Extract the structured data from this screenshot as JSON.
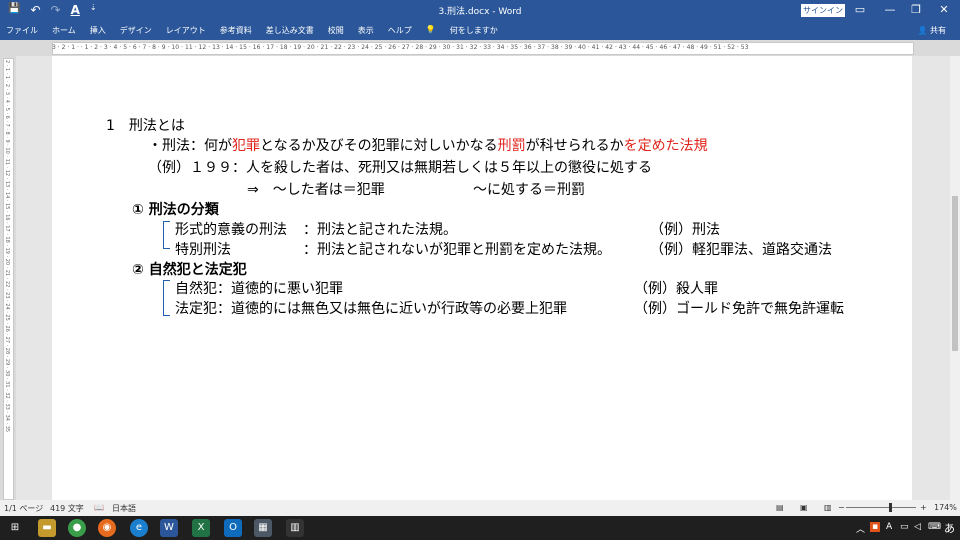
{
  "window": {
    "title": "3.刑法.docx  -  Word",
    "signin_label": "サインイン",
    "controls": [
      "▭",
      "—",
      "❐",
      "✕"
    ]
  },
  "qat": {
    "save_icon": "💾",
    "undo_icon": "↶",
    "redo_icon": "↷",
    "font_color_icon": "A",
    "customize_icon": "⇣"
  },
  "menu": {
    "tabs": [
      "ファイル",
      "ホーム",
      "挿入",
      "デザイン",
      "レイアウト",
      "参考資料",
      "差し込み文書",
      "校閲",
      "表示",
      "ヘルプ"
    ],
    "tellme": "何をしますか",
    "share": "共有"
  },
  "ruler": {
    "numbers": "3 ⸱ 2 ⸱ 1 ⸱  ⸱ 1 ⸱ 2 ⸱ 3 ⸱ 4 ⸱ 5 ⸱ 6 ⸱ 7 ⸱ 8 ⸱ 9 ⸱ 10 ⸱ 11 ⸱ 12 ⸱ 13 ⸱ 14 ⸱ 15 ⸱ 16 ⸱ 17 ⸱ 18 ⸱ 19 ⸱ 20 ⸱ 21 ⸱ 22 ⸱ 23 ⸱ 24 ⸱ 25 ⸱ 26 ⸱ 27 ⸱ 28 ⸱ 29 ⸱ 30 ⸱ 31 ⸱ 32 ⸱ 33 ⸱ 34 ⸱ 35 ⸱ 36 ⸱ 37 ⸱ 38 ⸱ 39 ⸱ 40 ⸱ 41 ⸱ 42 ⸱ 43 ⸱ 44 ⸱ 45 ⸱ 46 ⸱ 47 ⸱ 48 ⸱ 49 ⸱ 51 ⸱ 52 ⸱ 53"
  },
  "vruler": {
    "numbers": "2 · 1 · 1 · 2 · 3 · 4 · 5 · 6 · 7 · 8 · 9 · 10 · 11 · 12 · 13 · 14 · 15 · 16 · 17 · 18 · 19 · 20 · 21 · 22 · 23 · 24 · 25 · 26 · 27 · 28 · 29 · 30 · 31 · 32 · 33 · 34 · 35"
  },
  "document": {
    "heading": "1　刑法とは",
    "def_prefix": "・刑法：何が",
    "def_red1": "犯罪",
    "def_mid1": "となるか及びその犯罪に対しいかなる",
    "def_red2": "刑罰",
    "def_mid2": "が科せられるか",
    "def_red3": "を定めた法規",
    "example_line": "（例）１９９：人を殺した者は、死刑又は無期若しくは５年以上の懲役に処する",
    "arrow_line1": "⇒　～した者は＝犯罪",
    "arrow_line2": "～に処する＝刑罰",
    "section1": "①  刑法の分類",
    "s1_row1_label": "形式的意義の刑法",
    "s1_row1_text": "：刑法と記された法規。",
    "s1_row1_ex": "（例）刑法",
    "s1_row2_label": "特別刑法",
    "s1_row2_text": "：刑法と記されないが犯罪と刑罰を定めた法規。",
    "s1_row2_ex": "（例）軽犯罪法、道路交通法",
    "section2": "②  自然犯と法定犯",
    "s2_row1": "自然犯：道徳的に悪い犯罪",
    "s2_row1_ex": "（例）殺人罪",
    "s2_row2": "法定犯：道徳的には無色又は無色に近いが行政等の必要上犯罪",
    "s2_row2_ex": "（例）ゴールド免許で無免許運転"
  },
  "status": {
    "page": "1/1 ページ",
    "words": "419 文字",
    "language": "日本語",
    "zoom": "174%"
  },
  "taskbar": {
    "tray_lang": "あ",
    "tray_ime": "A"
  },
  "colors": {
    "accent": "#2b579a",
    "red_text": "#e0241b",
    "bracket": "#1f5fad"
  }
}
